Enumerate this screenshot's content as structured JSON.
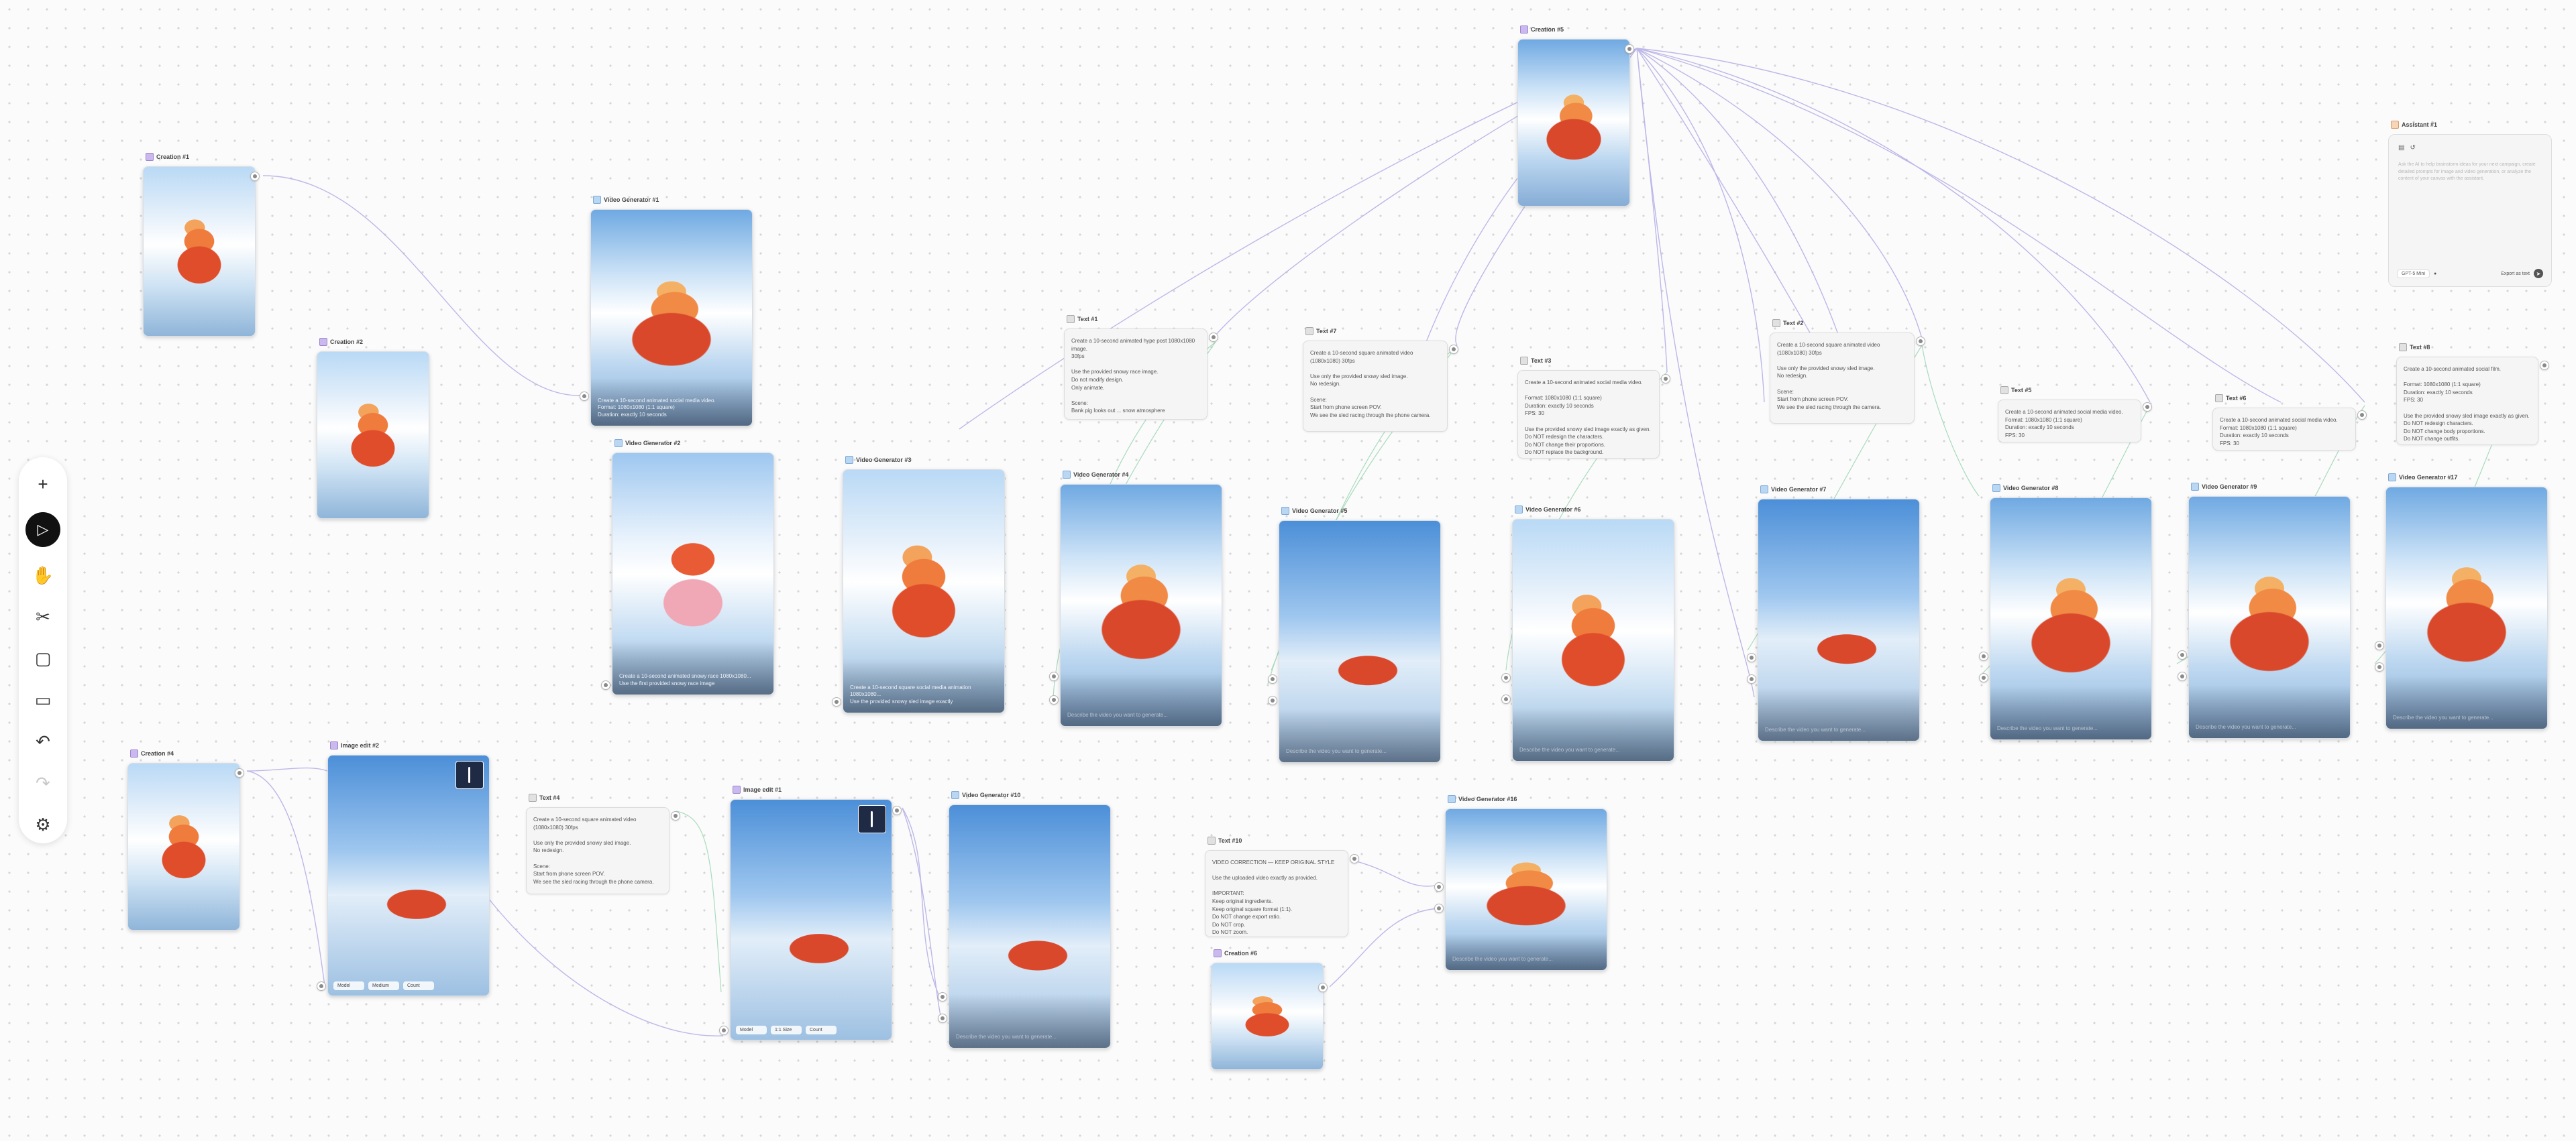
{
  "toolbar": {
    "tools": [
      {
        "name": "add-icon",
        "glyph": "+"
      },
      {
        "name": "select-pointer-icon",
        "glyph": "▷"
      },
      {
        "name": "hand-pan-icon",
        "glyph": "✋"
      },
      {
        "name": "scissors-icon",
        "glyph": "✂"
      },
      {
        "name": "frame-icon",
        "glyph": "▢"
      },
      {
        "name": "comment-icon",
        "glyph": "▭"
      },
      {
        "name": "undo-icon",
        "glyph": "↶"
      },
      {
        "name": "redo-icon",
        "glyph": "↷"
      },
      {
        "name": "settings-gear-icon",
        "glyph": "⚙"
      }
    ]
  },
  "nodes": {
    "creation1": {
      "label": "Creation #1"
    },
    "creation2": {
      "label": "Creation #2"
    },
    "creation4": {
      "label": "Creation #4"
    },
    "creation5": {
      "label": "Creation #5"
    },
    "creation6": {
      "label": "Creation #6"
    },
    "vg1": {
      "label": "Video Generator #1",
      "caption": "Create a 10-second animated social media video.\nFormat: 1080x1080 (1:1 square)\nDuration: exactly 10 seconds"
    },
    "vg2": {
      "label": "Video Generator #2",
      "caption": "Create a 10-second animated snowy race 1080x1080...\nUse the first provided snowy race image"
    },
    "vg3": {
      "label": "Video Generator #3",
      "caption": "Create a 10-second square social media animation 1080x1080...\nUse the provided snowy sled image exactly"
    },
    "vg4": {
      "label": "Video Generator #4",
      "caption": "Describe the video you want to generate..."
    },
    "vg5": {
      "label": "Video Generator #5",
      "caption": "Describe the video you want to generate..."
    },
    "vg6": {
      "label": "Video Generator #6",
      "caption": "Describe the video you want to generate..."
    },
    "vg7": {
      "label": "Video Generator #7",
      "caption": "Describe the video you want to generate..."
    },
    "vg8": {
      "label": "Video Generator #8",
      "caption": "Describe the video you want to generate..."
    },
    "vg9": {
      "label": "Video Generator #9",
      "caption": "Describe the video you want to generate..."
    },
    "vg10": {
      "label": "Video Generator #10",
      "caption": "Describe the video you want to generate..."
    },
    "vg17": {
      "label": "Video Generator #17",
      "caption": "Describe the video you want to generate..."
    },
    "vg16": {
      "label": "Video Generator #16",
      "caption": "Describe the video you want to generate..."
    },
    "imgedit2": {
      "label": "Image edit #2",
      "pills": [
        "Model",
        "Medium",
        "Count"
      ]
    },
    "imgedit1": {
      "label": "Image edit #1",
      "pills": [
        "Model",
        "1:1 Size",
        "Count"
      ]
    },
    "text1": {
      "label": "Text #1",
      "body": "Create a 10-second animated hype post 1080x1080 image.\n30fps\n\nUse the provided snowy race image.\nDo not modify design.\nOnly animate.\n\nScene:\nBank pig looks out ... snow atmosphere"
    },
    "text7": {
      "label": "Text #7",
      "body": "Create a 10-second square animated video (1080x1080) 30fps\n\nUse only the provided snowy sled image.\nNo redesign.\n\nScene:\nStart from phone screen POV.\nWe see the sled racing through the phone camera."
    },
    "text3": {
      "label": "Text #3",
      "body": "Create a 10-second animated social media video.\n\nFormat: 1080x1080 (1:1 square)\nDuration: exactly 10 seconds\nFPS: 30\n\nUse the provided snowy sled image exactly as given.\nDo NOT redesign the characters.\nDo NOT change their proportions.\nDo NOT replace the background."
    },
    "text2": {
      "label": "Text #2",
      "body": "Create a 10-second square animated video (1080x1080) 30fps\n\nUse only the provided snowy sled image.\nNo redesign.\n\nScene:\nStart from phone screen POV.\nWe see the sled racing through the camera."
    },
    "text5": {
      "label": "Text #5",
      "body": "Create a 10-second animated social media video.\nFormat: 1080x1080 (1:1 square)\nDuration: exactly 10 seconds\nFPS: 30"
    },
    "text6": {
      "label": "Text #6",
      "body": "Create a 10-second animated social media video.\nFormat: 1080x1080 (1:1 square)\nDuration: exactly 10 seconds\nFPS: 30"
    },
    "text8": {
      "label": "Text #8",
      "body": "Create a 10-second animated social film.\n\nFormat: 1080x1080 (1:1 square)\nDuration: exactly 10 seconds\nFPS: 30\n\nUse the provided snowy sled image exactly as given.\nDo NOT redesign characters.\nDo NOT change body proportions.\nDo NOT change outfits."
    },
    "text4": {
      "label": "Text #4",
      "body": "Create a 10-second square animated video (1080x1080) 30fps\n\nUse only the provided snowy sled image.\nNo redesign.\n\nScene:\nStart from phone screen POV.\nWe see the sled racing through the phone camera."
    },
    "text10": {
      "label": "Text #10",
      "body": "VIDEO CORRECTION — KEEP ORIGINAL STYLE\n\nUse the uploaded video exactly as provided.\n\nIMPORTANT:\nKeep original ingredients.\nKeep original square format (1:1).\nDo NOT change export ratio.\nDo NOT crop.\nDo NOT zoom."
    }
  },
  "assistant": {
    "label": "Assistant #1",
    "placeholder": "Ask the AI to help brainstorm ideas for your next campaign, create detailed prompts for image and video generation, or analyze the content of your canvas with the assistant.",
    "model": "GPT-5 Mini",
    "export": "Export as text"
  }
}
